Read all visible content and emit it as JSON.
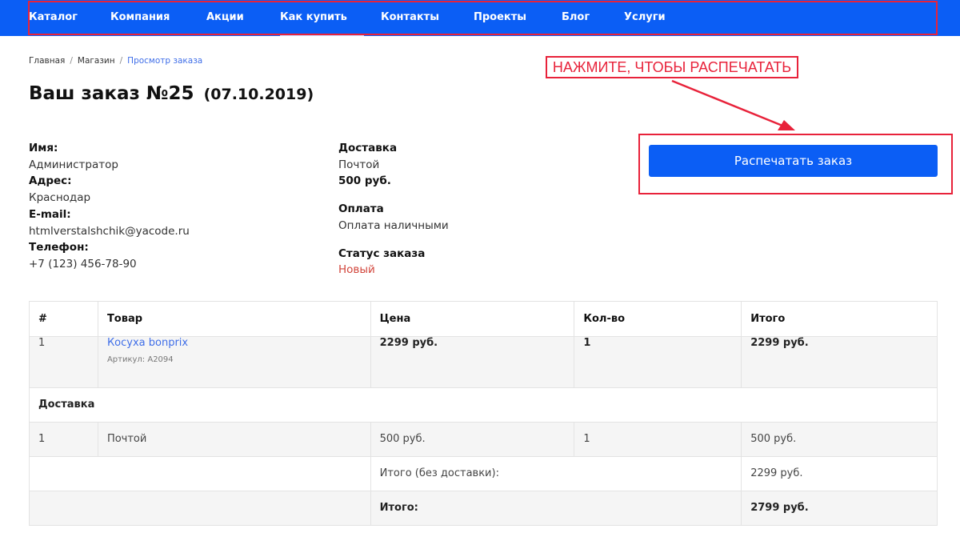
{
  "nav": {
    "items": [
      {
        "label": "Каталог"
      },
      {
        "label": "Компания"
      },
      {
        "label": "Акции"
      },
      {
        "label": "Как купить"
      },
      {
        "label": "Контакты"
      },
      {
        "label": "Проекты"
      },
      {
        "label": "Блог"
      },
      {
        "label": "Услуги"
      }
    ],
    "active": "Как купить"
  },
  "breadcrumb": {
    "home": "Главная",
    "shop": "Магазин",
    "current": "Просмотр заказа"
  },
  "title": {
    "main": "Ваш заказ №25",
    "date": "(07.10.2019)"
  },
  "annotation": {
    "text": "НАЖМИТЕ, ЧТОБЫ РАСПЕЧАТАТЬ"
  },
  "print_button": "Распечатать заказ",
  "customer": {
    "name_label": "Имя:",
    "name": "Администратор",
    "address_label": "Адрес:",
    "address": "Краснодар",
    "email_label": "E-mail:",
    "email": "htmlverstalshchik@yacode.ru",
    "phone_label": "Телефон:",
    "phone": "+7 (123) 456-78-90"
  },
  "order_info": {
    "delivery_label": "Доставка",
    "delivery_method": "Почтой",
    "delivery_price": "500 руб.",
    "payment_label": "Оплата",
    "payment_method": "Оплата наличными",
    "status_label": "Статус заказа",
    "status": "Новый"
  },
  "table": {
    "headers": [
      "#",
      "Товар",
      "Цена",
      "Кол-во",
      "Итого"
    ],
    "product": {
      "num": "1",
      "name": "Косуха bonprix",
      "sku": "Артикул: A2094",
      "price": "2299 руб.",
      "qty": "1",
      "total": "2299 руб."
    },
    "delivery_section": "Доставка",
    "delivery_row": {
      "num": "1",
      "name": "Почтой",
      "price": "500 руб.",
      "qty": "1",
      "total": "500 руб."
    },
    "subtotal_label": "Итого (без доставки):",
    "subtotal_value": "2299 руб.",
    "total_label": "Итого:",
    "total_value": "2799 руб."
  },
  "colors": {
    "nav_bg": "#0b5ef5",
    "annotation_red": "#e8223a",
    "link_blue": "#3f6ee8",
    "status_red": "#d2453b"
  }
}
